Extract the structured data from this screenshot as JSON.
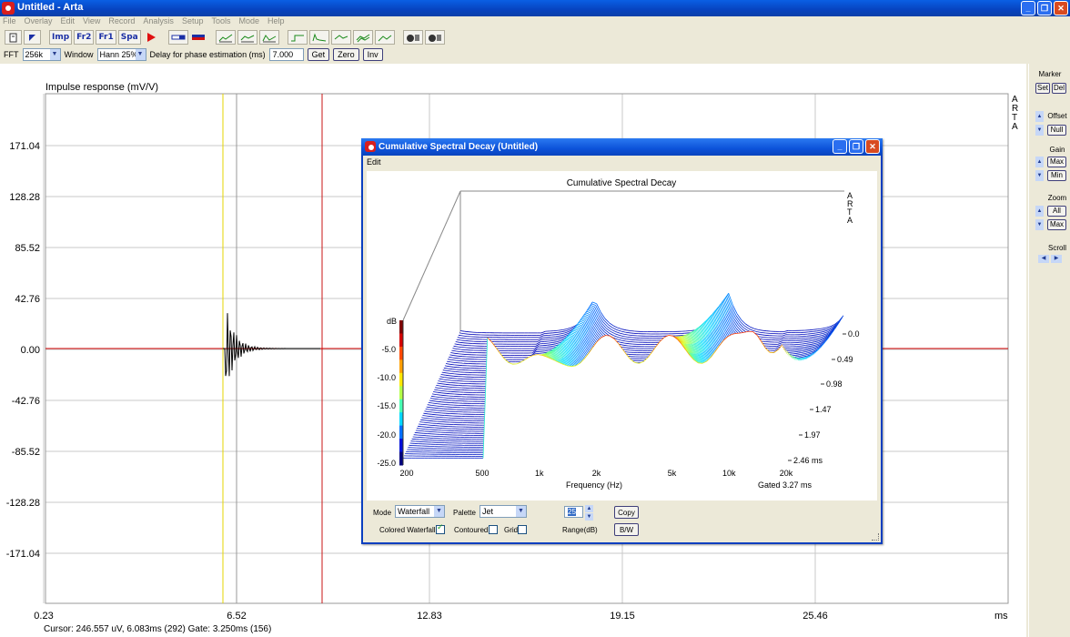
{
  "window": {
    "title": "Untitled - Arta",
    "min": "_",
    "max": "❐",
    "close": "✕"
  },
  "menu": [
    "File",
    "Overlay",
    "Edit",
    "View",
    "Record",
    "Analysis",
    "Setup",
    "Tools",
    "Mode",
    "Help"
  ],
  "toolbar": {
    "mode_buttons": [
      "Imp",
      "Fr2",
      "Fr1",
      "Spa"
    ],
    "graph_icons": [
      "fr-icon",
      "fr-icon",
      "fr-icon",
      "step-icon",
      "etc-icon",
      "nfr-icon",
      "csd-icon",
      "bd-icon",
      "sti-icon",
      "rasti-icon"
    ]
  },
  "params": {
    "fft_label": "FFT",
    "fft_value": "256k",
    "window_label": "Window",
    "window_value": "Hann 25%",
    "delay_label": "Delay for phase estimation (ms)",
    "delay_value": "7.000",
    "get": "Get",
    "zero": "Zero",
    "inv": "Inv"
  },
  "impulse": {
    "title": "Impulse response (mV/V)",
    "y_ticks": [
      "171.04",
      "128.28",
      "85.52",
      "42.76",
      "0.00",
      "-42.76",
      "-85.52",
      "-128.28",
      "-171.04"
    ],
    "x_ticks": [
      "0.23",
      "6.52",
      "12.83",
      "19.15",
      "25.46"
    ],
    "x_unit": "ms",
    "cursor_text": "Cursor: 246.557 uV, 6.083ms (292)  Gate: 3.250ms (156)",
    "arta_mark": [
      "A",
      "R",
      "T",
      "A"
    ],
    "colors": {
      "signal": "#000000",
      "baseline": "#d40000",
      "cursor": "#e5d400",
      "gate": "#c81414",
      "grid": "#c8c8c8"
    }
  },
  "right_panel": {
    "marker": "Marker",
    "set": "Set",
    "del": "Del",
    "offset": "Offset",
    "null": "Null",
    "gain": "Gain",
    "max": "Max",
    "min": "Min",
    "zoom": "Zoom",
    "all": "All",
    "zoom_max": "Max",
    "scroll": "Scroll"
  },
  "csd": {
    "window_title": "Cumulative Spectral Decay  (Untitled)",
    "edit_menu": "Edit",
    "plot_title": "Cumulative Spectral Decay",
    "db_label": "dB",
    "db_ticks": [
      "-5.0",
      "-10.0",
      "-15.0",
      "-20.0",
      "-25.0"
    ],
    "freq_ticks": [
      "200",
      "500",
      "1k",
      "2k",
      "5k",
      "10k",
      "20k"
    ],
    "freq_label": "Frequency (Hz)",
    "time_ticks": [
      "0.0",
      "0.49",
      "0.98",
      "1.47",
      "1.97",
      "2.46 ms"
    ],
    "gated_text": "Gated 3.27 ms",
    "arta_mark": [
      "A",
      "R",
      "T",
      "A"
    ],
    "controls": {
      "mode_label": "Mode",
      "mode_value": "Waterfall",
      "palette_label": "Palette",
      "palette_value": "Jet",
      "range_value": "25",
      "range_label": "Range(dB)",
      "copy": "Copy",
      "bw": "B/W",
      "colored_waterfall": "Colored Waterfall",
      "contoured": "Contoured",
      "grid": "Grid"
    }
  }
}
